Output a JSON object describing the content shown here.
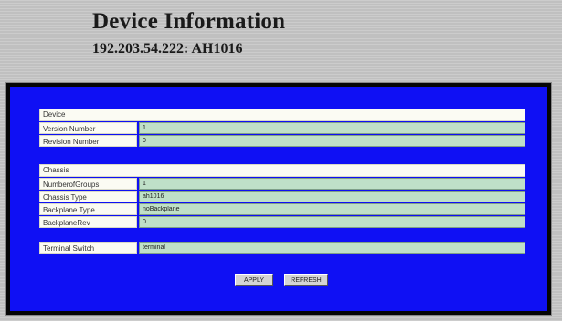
{
  "header": {
    "title": "Device Information",
    "subtitle": "192.203.54.222: AH1016"
  },
  "device": {
    "header": "Device",
    "rows": [
      {
        "label": "Version Number",
        "value": "1"
      },
      {
        "label": "Revision Number",
        "value": "0"
      }
    ]
  },
  "chassis": {
    "header": "Chassis",
    "rows": [
      {
        "label": "NumberofGroups",
        "value": "1"
      },
      {
        "label": "Chassis Type",
        "value": "ah1016"
      },
      {
        "label": "Backplane Type",
        "value": "noBackplane"
      },
      {
        "label": "BackplaneRev",
        "value": "0"
      }
    ]
  },
  "terminal": {
    "label": "Terminal Switch",
    "value": "terminal"
  },
  "buttons": {
    "apply": "APPLY",
    "refresh": "REFRESH"
  },
  "colors": {
    "panel": "#0f10f4",
    "field": "#bfe0c8",
    "label_bg": "#fbfbf3"
  }
}
